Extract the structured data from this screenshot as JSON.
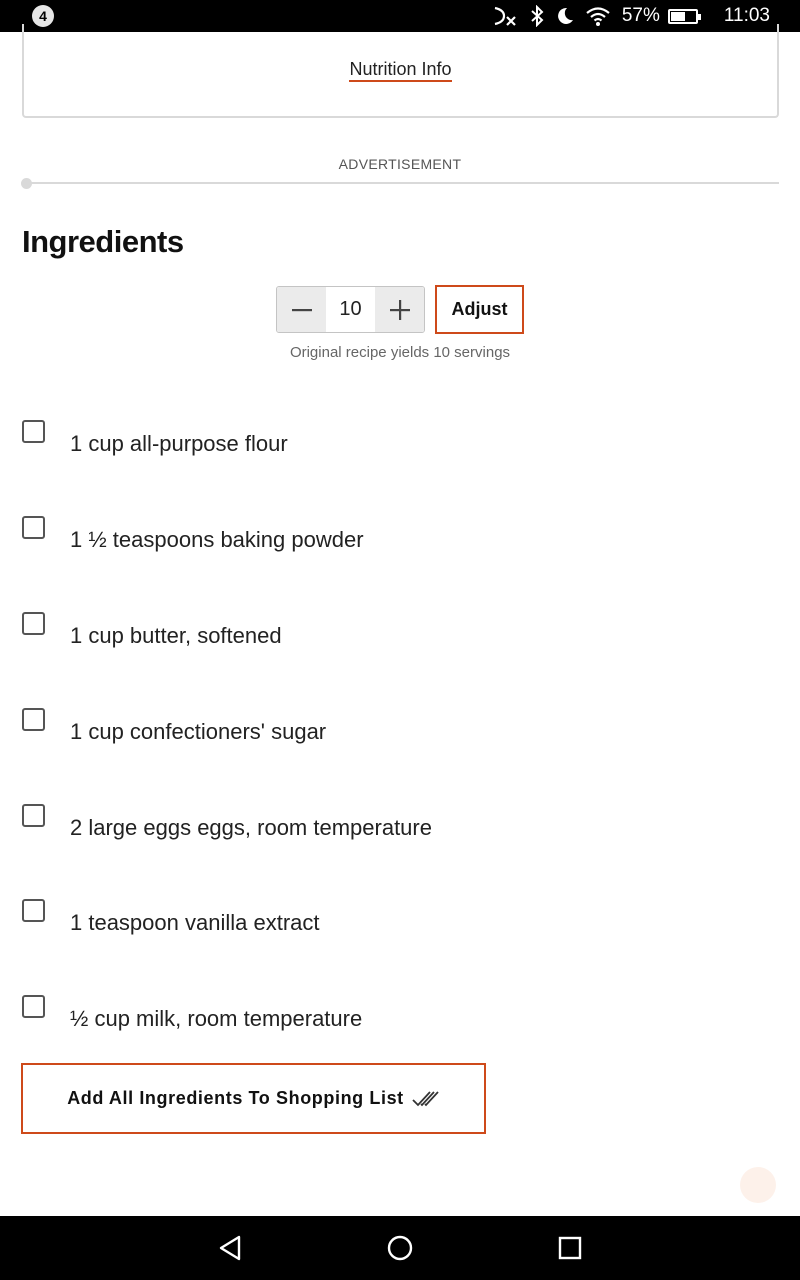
{
  "status_bar": {
    "notification_count": "4",
    "battery_percent": "57%",
    "battery_level": 0.57,
    "time": "11:03",
    "icons": [
      "bluetooth-off-icon",
      "bluetooth-icon",
      "do-not-disturb-icon",
      "wifi-icon",
      "battery-icon"
    ]
  },
  "nutrition": {
    "link_label": "Nutrition Info"
  },
  "advertisement": {
    "label": "ADVERTISEMENT"
  },
  "ingredients": {
    "title": "Ingredients",
    "servings": {
      "value": "10",
      "decrement_icon": "minus-icon",
      "increment_icon": "plus-icon",
      "adjust_label": "Adjust",
      "yield_note": "Original recipe yields 10 servings"
    },
    "items": [
      {
        "text": "1 cup all-purpose flour",
        "checked": false
      },
      {
        "text": "1 ½ teaspoons baking powder",
        "checked": false
      },
      {
        "text": "1 cup butter, softened",
        "checked": false
      },
      {
        "text": "1 cup confectioners' sugar",
        "checked": false
      },
      {
        "text": "2 large eggs eggs, room temperature",
        "checked": false
      },
      {
        "text": "1 teaspoon vanilla extract",
        "checked": false
      },
      {
        "text": "½ cup milk, room temperature",
        "checked": false
      }
    ],
    "shopping_button_label": "Add All Ingredients To Shopping List",
    "shopping_button_icon": "double-check-icon"
  },
  "nav_bar": {
    "icons": [
      "back-icon",
      "home-icon",
      "recents-icon"
    ]
  },
  "colors": {
    "accent": "#ce4a1a",
    "status_bar_bg": "#000000",
    "border": "#d9d9d9"
  }
}
